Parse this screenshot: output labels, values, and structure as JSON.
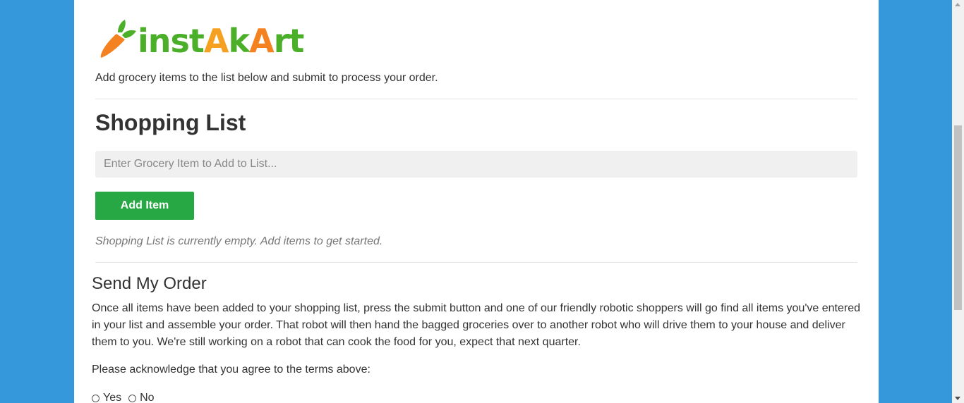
{
  "colors": {
    "page_background": "#3498db",
    "content_background": "#ffffff",
    "accent_green": "#28a745",
    "logo_green": "#4caf2a",
    "logo_orange": "#f58220"
  },
  "header": {
    "logo_text": "instAkArt",
    "logo_icon": "carrot-icon",
    "intro": "Add grocery items to the list below and submit to process your order."
  },
  "shopping_list": {
    "heading": "Shopping List",
    "input_placeholder": "Enter Grocery Item to Add to List...",
    "input_value": "",
    "add_button_label": "Add Item",
    "empty_message": "Shopping List is currently empty. Add items to get started."
  },
  "order": {
    "heading": "Send My Order",
    "description": "Once all items have been added to your shopping list, press the submit button and one of our friendly robotic shoppers will go find all items you've entered in your list and assemble your order. That robot will then hand the bagged groceries over to another robot who will drive them to your house and deliver them to you. We're still working on a robot that can cook the food for you, expect that next quarter.",
    "acknowledge_prompt": "Please acknowledge that you agree to the terms above:",
    "options": [
      {
        "label": "Yes",
        "selected": false
      },
      {
        "label": "No",
        "selected": false
      }
    ]
  }
}
